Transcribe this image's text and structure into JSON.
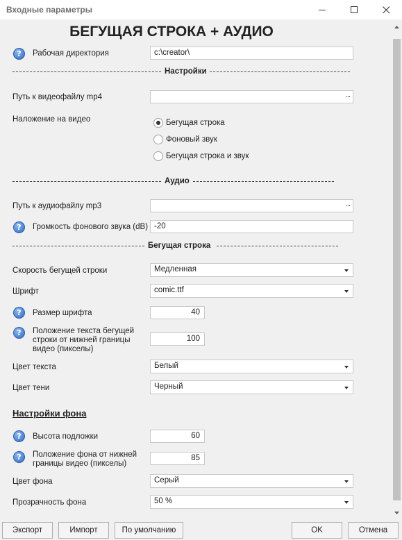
{
  "window": {
    "title": "Входные параметры"
  },
  "main_title": "БЕГУЩАЯ СТРОКА + АУДИО",
  "work_dir": {
    "label": "Рабочая директория",
    "value": "c:\\creator\\"
  },
  "sections": {
    "settings": "Настройки",
    "audio": "Аудио",
    "ticker": "Бегущая строка"
  },
  "video_path": {
    "label": "Путь к видеофайлу mp4",
    "value": "",
    "browse": "..."
  },
  "overlay": {
    "label": "Наложение на видео",
    "options": [
      "Бегущая строка",
      "Фоновый звук",
      "Бегущая строка и звук"
    ],
    "selected_index": 0
  },
  "audio_path": {
    "label": "Путь к аудиофайлу mp3",
    "value": "",
    "browse": "..."
  },
  "bg_volume": {
    "label": "Громкость фонового звука (dB)",
    "value": "-20"
  },
  "ticker_speed": {
    "label": "Скорость бегущей строки",
    "value": "Медленная"
  },
  "font": {
    "label": "Шрифт",
    "value": "comic.ttf"
  },
  "font_size": {
    "label": "Размер шрифта",
    "value": "40"
  },
  "text_pos": {
    "label_1": "Положение текста бегущей",
    "label_2": "строки от нижней границы",
    "label_3": "видео (пикселы)",
    "value": "100"
  },
  "text_color": {
    "label": "Цвет текста",
    "value": "Белый"
  },
  "shadow_color": {
    "label": "Цвет тени",
    "value": "Черный"
  },
  "bg_settings": {
    "heading": "Настройки фона"
  },
  "bg_height": {
    "label": "Высота подложки",
    "value": "60"
  },
  "bg_pos": {
    "label_1": "Положение фона от нижней",
    "label_2": "границы видео (пикселы)",
    "value": "85"
  },
  "bg_color": {
    "label": "Цвет фона",
    "value": "Серый"
  },
  "bg_opacity": {
    "label": "Прозрачность фона",
    "value": "50 %"
  },
  "buttons": {
    "export": "Экспорт",
    "import": "Импорт",
    "default": "По умолчанию",
    "ok": "OK",
    "cancel": "Отмена"
  },
  "icons": {
    "help": "question-icon",
    "minimize": "minimize-icon",
    "maximize": "maximize-icon",
    "close": "close-icon"
  }
}
